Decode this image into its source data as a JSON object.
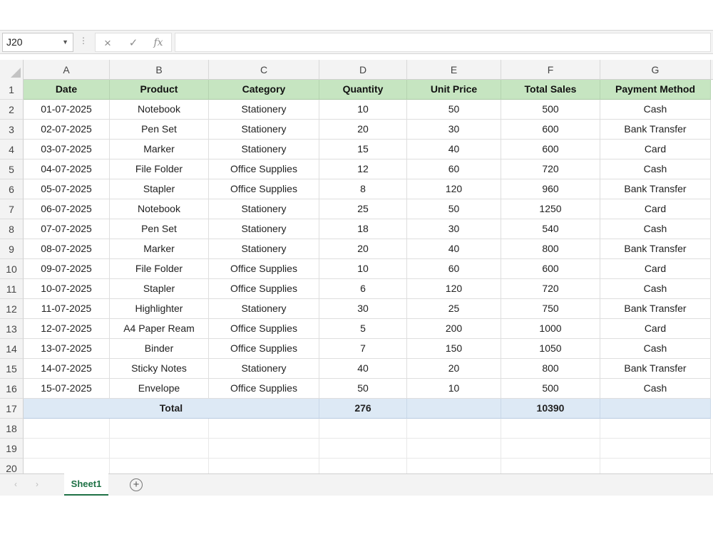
{
  "formula_bar": {
    "cell_ref": "J20",
    "dots": "⋮",
    "cancel_icon": "×",
    "enter_icon": "✓",
    "fx_label": "fx",
    "formula": ""
  },
  "columns": [
    "A",
    "B",
    "C",
    "D",
    "E",
    "F",
    "G"
  ],
  "header": {
    "row_num": "1",
    "cells": [
      "Date",
      "Product",
      "Category",
      "Quantity",
      "Unit Price",
      "Total Sales",
      "Payment Method"
    ]
  },
  "rows": [
    {
      "num": "2",
      "cells": [
        "01-07-2025",
        "Notebook",
        "Stationery",
        "10",
        "50",
        "500",
        "Cash"
      ]
    },
    {
      "num": "3",
      "cells": [
        "02-07-2025",
        "Pen Set",
        "Stationery",
        "20",
        "30",
        "600",
        "Bank Transfer"
      ]
    },
    {
      "num": "4",
      "cells": [
        "03-07-2025",
        "Marker",
        "Stationery",
        "15",
        "40",
        "600",
        "Card"
      ]
    },
    {
      "num": "5",
      "cells": [
        "04-07-2025",
        "File Folder",
        "Office Supplies",
        "12",
        "60",
        "720",
        "Cash"
      ]
    },
    {
      "num": "6",
      "cells": [
        "05-07-2025",
        "Stapler",
        "Office Supplies",
        "8",
        "120",
        "960",
        "Bank Transfer"
      ]
    },
    {
      "num": "7",
      "cells": [
        "06-07-2025",
        "Notebook",
        "Stationery",
        "25",
        "50",
        "1250",
        "Card"
      ]
    },
    {
      "num": "8",
      "cells": [
        "07-07-2025",
        "Pen Set",
        "Stationery",
        "18",
        "30",
        "540",
        "Cash"
      ]
    },
    {
      "num": "9",
      "cells": [
        "08-07-2025",
        "Marker",
        "Stationery",
        "20",
        "40",
        "800",
        "Bank Transfer"
      ]
    },
    {
      "num": "10",
      "cells": [
        "09-07-2025",
        "File Folder",
        "Office Supplies",
        "10",
        "60",
        "600",
        "Card"
      ]
    },
    {
      "num": "11",
      "cells": [
        "10-07-2025",
        "Stapler",
        "Office Supplies",
        "6",
        "120",
        "720",
        "Cash"
      ]
    },
    {
      "num": "12",
      "cells": [
        "11-07-2025",
        "Highlighter",
        "Stationery",
        "30",
        "25",
        "750",
        "Bank Transfer"
      ]
    },
    {
      "num": "13",
      "cells": [
        "12-07-2025",
        "A4 Paper Ream",
        "Office Supplies",
        "5",
        "200",
        "1000",
        "Card"
      ]
    },
    {
      "num": "14",
      "cells": [
        "13-07-2025",
        "Binder",
        "Office Supplies",
        "7",
        "150",
        "1050",
        "Cash"
      ]
    },
    {
      "num": "15",
      "cells": [
        "14-07-2025",
        "Sticky Notes",
        "Stationery",
        "40",
        "20",
        "800",
        "Bank Transfer"
      ]
    },
    {
      "num": "16",
      "cells": [
        "15-07-2025",
        "Envelope",
        "Office Supplies",
        "50",
        "10",
        "500",
        "Cash"
      ]
    }
  ],
  "total_row": {
    "num": "17",
    "label": "Total",
    "quantity": "276",
    "total_sales": "10390"
  },
  "empty_rows": [
    "18",
    "19",
    "20"
  ],
  "sheet_tabs": {
    "prev_icon": "‹",
    "next_icon": "›",
    "active": "Sheet1",
    "add_icon": "+"
  }
}
